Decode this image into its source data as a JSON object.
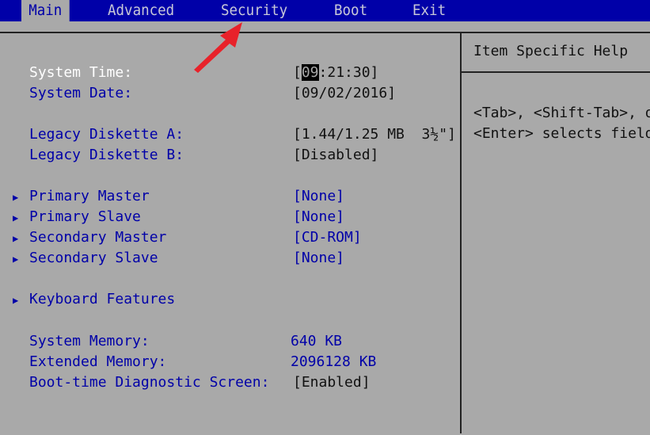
{
  "menu": {
    "tabs": [
      "Main",
      "Advanced",
      "Security",
      "Boot",
      "Exit"
    ]
  },
  "main": {
    "system_time": {
      "label": "System Time:",
      "hour": "09",
      "rest": ":21:30]",
      "open": "["
    },
    "system_date": {
      "label": "System Date:",
      "value": "[09/02/2016]"
    },
    "diskette_a": {
      "label": "Legacy Diskette A:",
      "value": "[1.44/1.25 MB  3½\"]"
    },
    "diskette_b": {
      "label": "Legacy Diskette B:",
      "value": "[Disabled]"
    },
    "submenus": [
      {
        "label": "Primary Master",
        "value": "[None]"
      },
      {
        "label": "Primary Slave",
        "value": "[None]"
      },
      {
        "label": "Secondary Master",
        "value": "[CD-ROM]"
      },
      {
        "label": "Secondary Slave",
        "value": "[None]"
      },
      {
        "label": "Keyboard Features",
        "value": ""
      }
    ],
    "system_memory": {
      "label": "System Memory:",
      "value": "640 KB"
    },
    "extended_memory": {
      "label": "Extended Memory:",
      "value": "2096128 KB"
    },
    "boot_diag": {
      "label": "Boot-time Diagnostic Screen:",
      "value": "[Enabled]"
    }
  },
  "help": {
    "title": "Item Specific Help",
    "line1": "<Tab>, <Shift-Tab>, or",
    "line2": "<Enter> selects field."
  },
  "colors": {
    "blue": "#0000a8",
    "gray": "#a9a9a9",
    "arrow": "#e8222a"
  }
}
